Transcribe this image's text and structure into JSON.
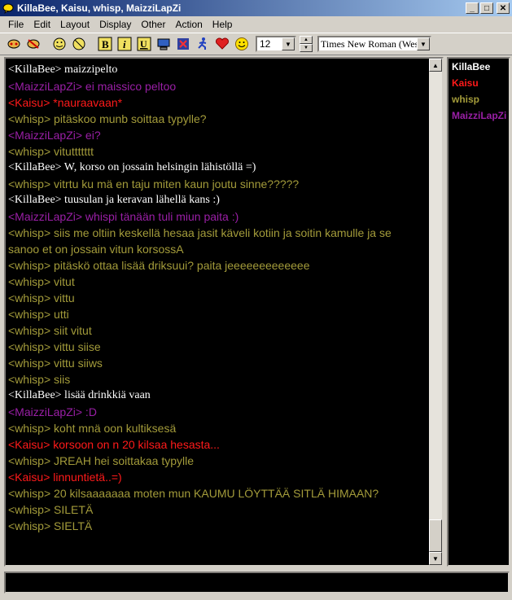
{
  "window": {
    "title": "KillaBee, Kaisu, whisp, MaizziLapZi",
    "minimize_glyph": "_",
    "maximize_glyph": "□",
    "close_glyph": "✕"
  },
  "menu": [
    {
      "label": "File"
    },
    {
      "label": "Edit"
    },
    {
      "label": "Layout"
    },
    {
      "label": "Display"
    },
    {
      "label": "Other"
    },
    {
      "label": "Action"
    },
    {
      "label": "Help"
    }
  ],
  "toolbar": {
    "font_size": "12",
    "font_name": "Times New Roman (Wes"
  },
  "colors": {
    "KillaBee": "#ffffff",
    "MaizziLapZi": "#9a1fa6",
    "Kaisu": "#ff1a1a",
    "whisp": "#a39b3a"
  },
  "messages": [
    {
      "text": "<KillaBee> maizzipelto",
      "cls": "nick-white"
    },
    {
      "text": "<MaizziLapZi> ei maissico peltoo",
      "cls": "nick-purple"
    },
    {
      "text": "<Kaisu> *nauraavaan*",
      "cls": "nick-red"
    },
    {
      "text": "<whisp> pitäskoo munb soittaa typylle?",
      "cls": "nick-olive"
    },
    {
      "text": "<MaizziLapZi> ei?",
      "cls": "nick-purple"
    },
    {
      "text": "<whisp> vituttttttt",
      "cls": "nick-olive"
    },
    {
      "text": "<KillaBee> W, korso on jossain helsingin lähistöllä =)",
      "cls": "nick-white"
    },
    {
      "text": "<whisp> vitrtu ku mä en taju miten kaun joutu sinne?????",
      "cls": "nick-olive"
    },
    {
      "text": "<KillaBee> tuusulan ja keravan lähellä kans :)",
      "cls": "nick-white"
    },
    {
      "text": "<MaizziLapZi> whispi tänään tuli miun paita :)",
      "cls": "nick-purple"
    },
    {
      "text": "<whisp> siis me oltiin keskellä hesaa jasit käveli kotiin ja soitin kamulle ja se sanoo et on jossain vitun korsossA",
      "cls": "nick-olive"
    },
    {
      "text": "<whisp> pitäskö ottaa lisää driksuui? paita jeeeeeeeeeeeee",
      "cls": "nick-olive"
    },
    {
      "text": "<whisp> vitut",
      "cls": "nick-olive"
    },
    {
      "text": "<whisp> vittu",
      "cls": "nick-olive"
    },
    {
      "text": "<whisp> utti",
      "cls": "nick-olive"
    },
    {
      "text": "<whisp> siit vitut",
      "cls": "nick-olive"
    },
    {
      "text": "<whisp> vittu siise",
      "cls": "nick-olive"
    },
    {
      "text": "<whisp> vittu siiws",
      "cls": "nick-olive"
    },
    {
      "text": "<whisp> siis",
      "cls": "nick-olive"
    },
    {
      "text": "<KillaBee> lisää drinkkiä vaan",
      "cls": "nick-white"
    },
    {
      "text": "<MaizziLapZi> :D",
      "cls": "nick-purple"
    },
    {
      "text": "<whisp> koht mnä oon kultiksesä",
      "cls": "nick-olive"
    },
    {
      "text": "<Kaisu> korsoon on n 20 kilsaa hesasta...",
      "cls": "nick-red"
    },
    {
      "text": "<whisp> JREAH hei soittakaa typylle",
      "cls": "nick-olive"
    },
    {
      "text": "<Kaisu> linnuntietä..=)",
      "cls": "nick-red"
    },
    {
      "text": "<whisp> 20 kilsaaaaaaa moten mun KAUMU LÖYTTÄÄ SITLÄ HIMAAN?",
      "cls": "nick-olive"
    },
    {
      "text": "<whisp> SILETÄ",
      "cls": "nick-olive"
    },
    {
      "text": "<whisp> SIELTÄ",
      "cls": "nick-olive"
    }
  ],
  "nicks": [
    {
      "name": "KillaBee",
      "color": "#ffffff"
    },
    {
      "name": "Kaisu",
      "color": "#ff1a1a"
    },
    {
      "name": "whisp",
      "color": "#a39b3a"
    },
    {
      "name": "MaizziLapZi",
      "color": "#9a1fa6"
    }
  ],
  "input": {
    "value": ""
  }
}
